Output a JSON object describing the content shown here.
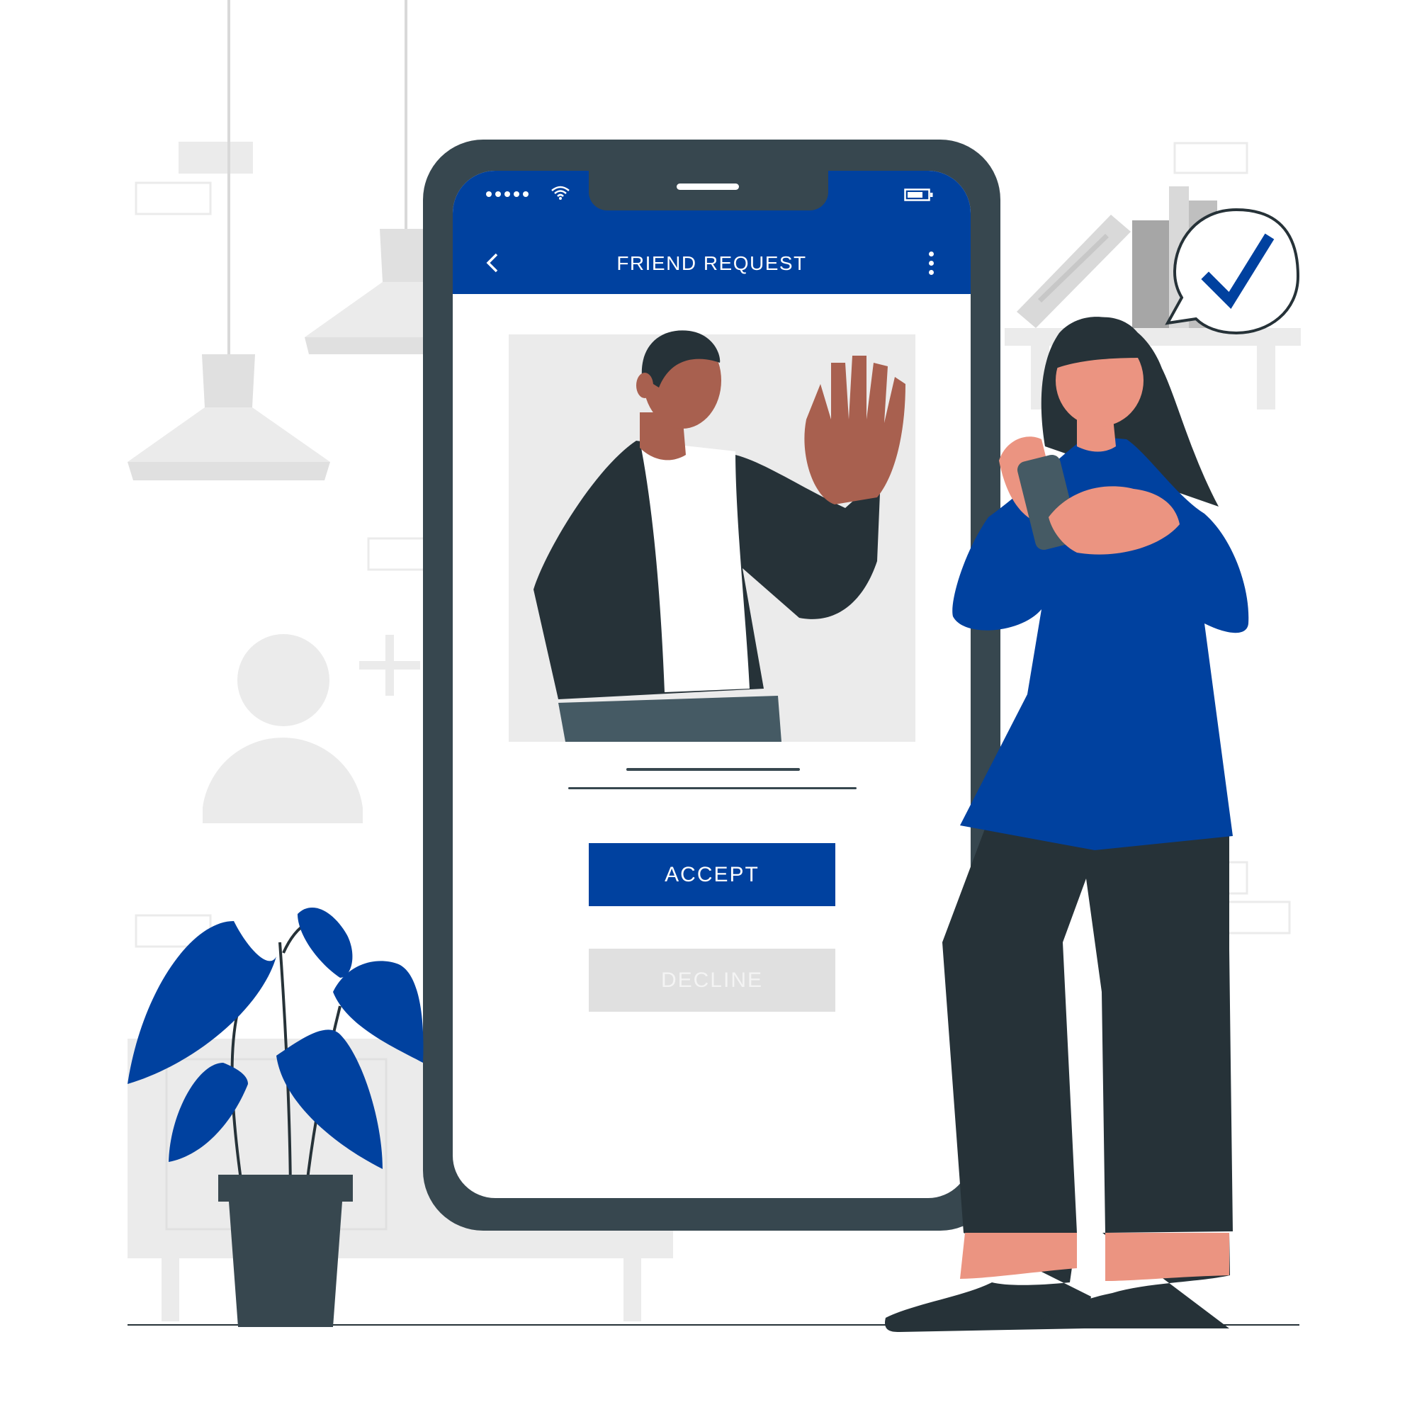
{
  "header": {
    "title": "FRIEND REQUEST",
    "back_icon": "chevron-left-icon",
    "menu_icon": "more-vertical-icon"
  },
  "status_bar": {
    "icons": [
      "signal-dots-icon",
      "wifi-icon",
      "battery-icon"
    ]
  },
  "actions": {
    "accept_label": "ACCEPT",
    "decline_label": "DECLINE"
  },
  "colors": {
    "brand": "#00419f",
    "phone_frame": "#37474f",
    "decline_bg": "#e0e0e0",
    "background_gray": "#ebebeb"
  }
}
